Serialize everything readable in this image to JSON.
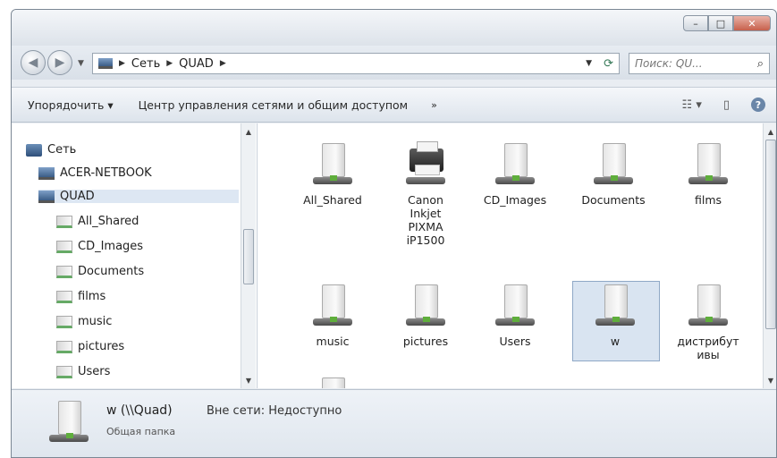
{
  "window": {
    "caption_buttons": [
      "–",
      "□",
      "✕"
    ]
  },
  "address": {
    "crumbs": [
      "Сеть",
      "QUAD"
    ],
    "search_placeholder": "Поиск: QU..."
  },
  "toolbar": {
    "organize": "Упорядочить ▾",
    "network_center": "Центр управления сетями и общим доступом",
    "more": "»"
  },
  "navpane": {
    "items": [
      {
        "label": "Сеть",
        "icon": "network-icon"
      },
      {
        "label": "ACER-NETBOOK",
        "icon": "computer-icon"
      },
      {
        "label": "QUAD",
        "icon": "computer-icon"
      },
      {
        "label": "All_Shared",
        "icon": "shared-folder-icon"
      },
      {
        "label": "CD_Images",
        "icon": "shared-folder-icon"
      },
      {
        "label": "Documents",
        "icon": "shared-folder-icon"
      },
      {
        "label": "films",
        "icon": "shared-folder-icon"
      },
      {
        "label": "music",
        "icon": "shared-folder-icon"
      },
      {
        "label": "pictures",
        "icon": "shared-folder-icon"
      },
      {
        "label": "Users",
        "icon": "shared-folder-icon"
      }
    ]
  },
  "content": {
    "items": [
      {
        "label": "All_Shared",
        "icon": "shared-folder-icon"
      },
      {
        "label": "Canon Inkjet PIXMA iP1500",
        "icon": "printer-icon"
      },
      {
        "label": "CD_Images",
        "icon": "shared-folder-icon"
      },
      {
        "label": "Documents",
        "icon": "shared-folder-icon"
      },
      {
        "label": "films",
        "icon": "shared-folder-icon"
      },
      {
        "label": "music",
        "icon": "shared-folder-icon"
      },
      {
        "label": "pictures",
        "icon": "shared-folder-icon"
      },
      {
        "label": "Users",
        "icon": "shared-folder-icon"
      },
      {
        "label": "w",
        "icon": "shared-folder-icon",
        "selected": true
      },
      {
        "label": "дистрибутивы",
        "icon": "shared-folder-icon"
      }
    ]
  },
  "status": {
    "name": "w (\\\\Quad)",
    "state": "Вне сети: Недоступно",
    "type": "Общая папка"
  }
}
